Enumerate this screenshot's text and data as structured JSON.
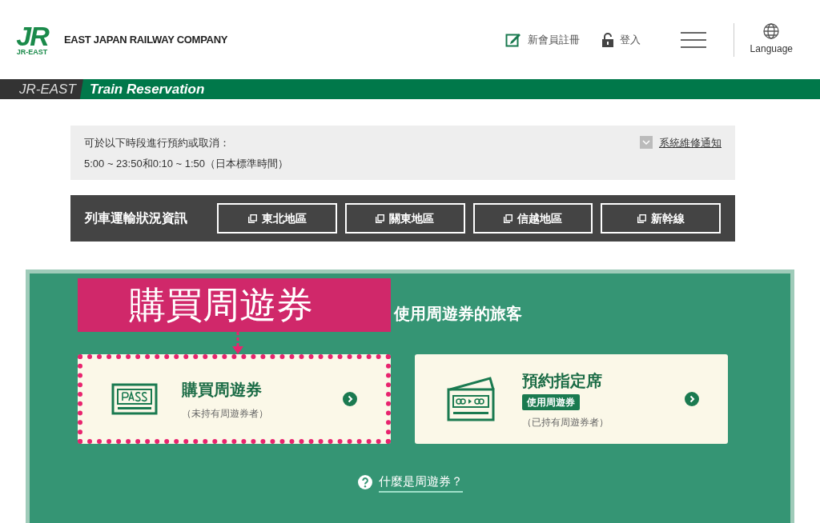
{
  "header": {
    "logo_mark": "JR",
    "logo_sub": "JR-EAST",
    "company": "EAST JAPAN RAILWAY COMPANY",
    "register": "新會員註冊",
    "login": "登入",
    "language": "Language"
  },
  "banner": {
    "brand": "JR-EAST",
    "title": "Train Reservation"
  },
  "notice": {
    "lines": [
      "可於以下時段進行預約或取消：",
      "5:00 ~ 23:50和0:10 ~ 1:50（日本標準時間）"
    ],
    "link": "系統維修通知"
  },
  "status": {
    "label": "列車運輸狀況資訊",
    "regions": [
      "東北地區",
      "關東地區",
      "信越地區",
      "新幹線"
    ]
  },
  "section": {
    "heading": "使用周遊券的旅客",
    "annotation": "購買周遊券",
    "cards": [
      {
        "kind": "pass",
        "title": "購買周遊券",
        "subtitle": "（未持有周遊券者）",
        "highlighted": true
      },
      {
        "kind": "ticket",
        "title": "預約指定席",
        "tag": "使用周遊券",
        "subtitle": "（已持有周遊券者）",
        "highlighted": false
      }
    ],
    "help": "什麼是周遊券？"
  }
}
